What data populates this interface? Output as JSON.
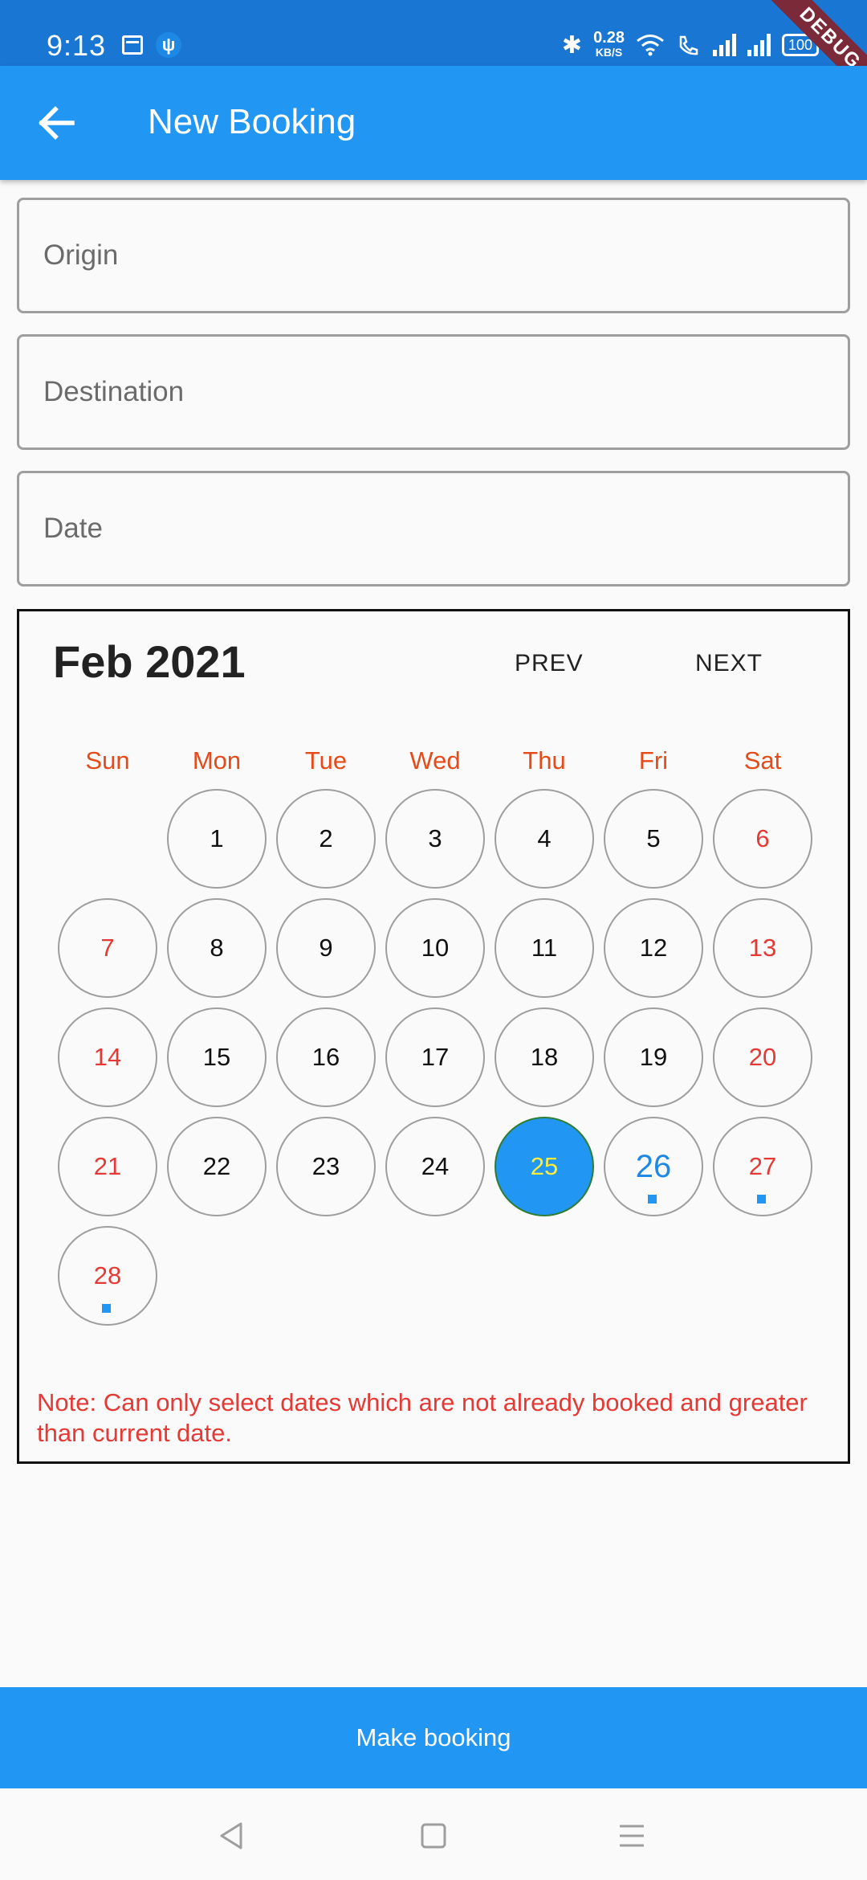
{
  "status_bar": {
    "time": "9:13",
    "speed_value": "0.28",
    "speed_unit": "KB/S",
    "battery": "100",
    "debug_label": "DEBUG"
  },
  "app_bar": {
    "title": "New Booking",
    "back_icon": "arrow-back-icon"
  },
  "form": {
    "origin_placeholder": "Origin",
    "destination_placeholder": "Destination",
    "date_placeholder": "Date"
  },
  "calendar": {
    "month_label": "Feb 2021",
    "prev_label": "PREV",
    "next_label": "NEXT",
    "weekdays": [
      "Sun",
      "Mon",
      "Tue",
      "Wed",
      "Thu",
      "Fri",
      "Sat"
    ],
    "days": [
      "1",
      "2",
      "3",
      "4",
      "5",
      "6",
      "7",
      "8",
      "9",
      "10",
      "11",
      "12",
      "13",
      "14",
      "15",
      "16",
      "17",
      "18",
      "19",
      "20",
      "21",
      "22",
      "23",
      "24",
      "25",
      "26",
      "27",
      "28"
    ],
    "first_weekday_index": 1,
    "selected_day": "25",
    "marked_days": [
      "26",
      "27",
      "28"
    ],
    "note": "Note: Can only select dates which are not already booked and greater than current date."
  },
  "actions": {
    "make_booking_label": "Make booking"
  },
  "colors": {
    "primary": "#2196f3",
    "status_bar": "#1976d2",
    "weekend_text": "#e53935",
    "weekday_header": "#e64a19",
    "selected_text": "#ffeb3b",
    "selected_border": "#2e7d32"
  },
  "nav_bar": {
    "back_icon": "triangle-back-icon",
    "home_icon": "square-home-icon",
    "menu_icon": "menu-lines-icon"
  }
}
